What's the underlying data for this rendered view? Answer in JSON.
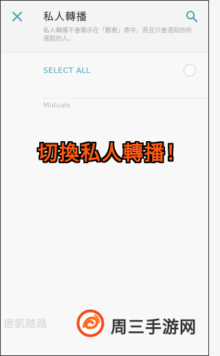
{
  "header": {
    "title": "私人轉播",
    "subtitle": "私人轉播不會顯示在「觀看」表中，而且只會通知你所選取的人。",
    "icons": {
      "close": "close-icon",
      "search": "search-icon"
    },
    "colors": {
      "accent": "#4aa7b7",
      "title": "#2c2c2c"
    }
  },
  "list": {
    "select_all_label": "SELECT ALL",
    "section_label": "Mutuals"
  },
  "overlay": {
    "caption": "切換私人轉播！",
    "color": "#ff5a14"
  },
  "watermark": {
    "left_text": "痞凱踏踏",
    "brand_text": "周三手游网"
  }
}
